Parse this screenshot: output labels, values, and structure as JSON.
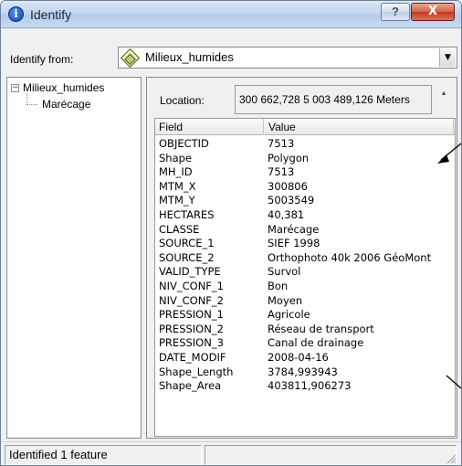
{
  "window": {
    "title": "Identify",
    "help_label": "?",
    "close_label": "X"
  },
  "identify_from": {
    "label": "Identify from:",
    "selected": "Milieux_humides"
  },
  "tree": {
    "root_label": "Milieux_humides",
    "toggle": "−",
    "child_label": "Marécage"
  },
  "location": {
    "label": "Location:",
    "value": "300 662,728  5 003 489,126 Meters"
  },
  "grid": {
    "columns": [
      "Field",
      "Value"
    ],
    "rows": [
      {
        "field": "OBJECTID",
        "value": "7513"
      },
      {
        "field": "Shape",
        "value": "Polygon"
      },
      {
        "field": "MH_ID",
        "value": "7513"
      },
      {
        "field": "MTM_X",
        "value": "300806"
      },
      {
        "field": "MTM_Y",
        "value": "5003549"
      },
      {
        "field": "HECTARES",
        "value": "40,381"
      },
      {
        "field": "CLASSE",
        "value": "Marécage"
      },
      {
        "field": "SOURCE_1",
        "value": "SIEF 1998"
      },
      {
        "field": "SOURCE_2",
        "value": "Orthophoto 40k 2006 GéoMont"
      },
      {
        "field": "VALID_TYPE",
        "value": "Survol"
      },
      {
        "field": "NIV_CONF_1",
        "value": "Bon"
      },
      {
        "field": "NIV_CONF_2",
        "value": "Moyen"
      },
      {
        "field": "PRESSION_1",
        "value": "Agricole"
      },
      {
        "field": "PRESSION_2",
        "value": "Réseau de transport"
      },
      {
        "field": "PRESSION_3",
        "value": "Canal de drainage"
      },
      {
        "field": "DATE_MODIF",
        "value": "2008-04-16"
      },
      {
        "field": "Shape_Length",
        "value": "3784,993943"
      },
      {
        "field": "Shape_Area",
        "value": "403811,906273"
      }
    ]
  },
  "status": {
    "text": "Identified 1 feature"
  },
  "icons": {
    "title": "info-icon",
    "layer": "layer-icon",
    "dropdown": "chevron-down-icon",
    "location_menu": "location-options-icon",
    "grip": "resize-grip-icon"
  }
}
